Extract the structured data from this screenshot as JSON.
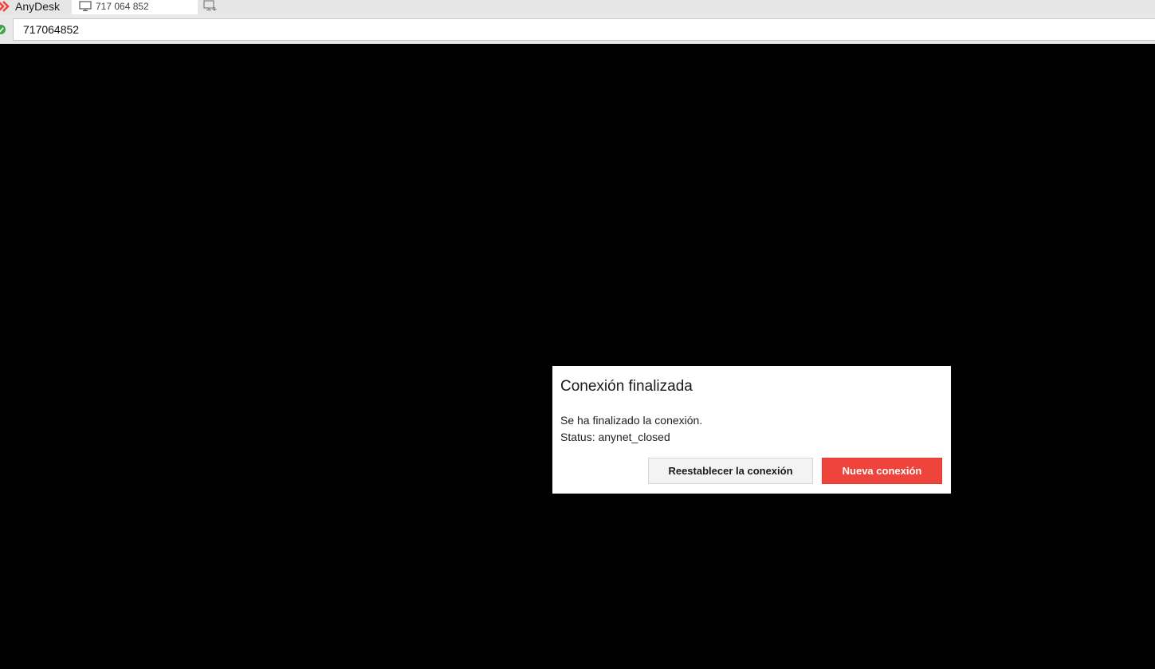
{
  "app": {
    "name": "AnyDesk",
    "accent_color": "#ef443b"
  },
  "tab": {
    "label": "717 064 852",
    "icon": "monitor-icon"
  },
  "new_tab_icon": "new-session-icon",
  "address": {
    "value": "717064852",
    "status_icon": "connected-check-icon",
    "status_color": "#3aa64a"
  },
  "dialog": {
    "title": "Conexión finalizada",
    "message": "Se ha finalizado la conexión.",
    "status": "Status: anynet_closed",
    "reconnect_label": "Reestablecer la conexión",
    "new_connection_label": "Nueva conexión"
  }
}
